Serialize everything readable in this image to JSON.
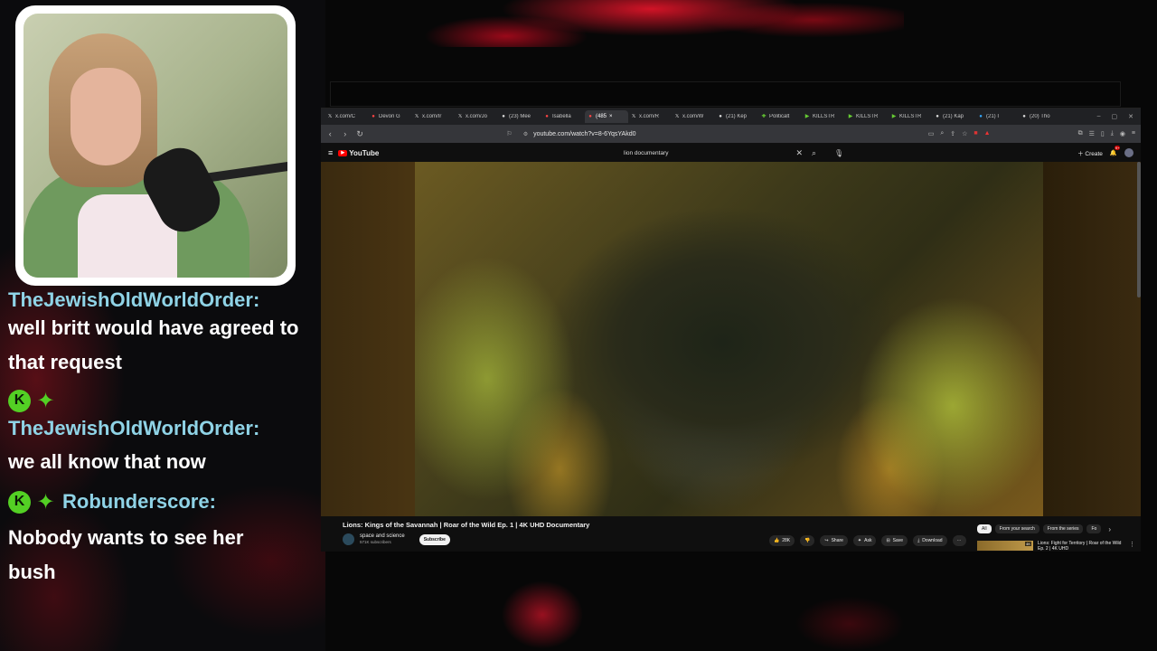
{
  "chat": {
    "lines": [
      {
        "user": "TheJewishOldWorldOrder:",
        "message": "well britt would have agreed to that request"
      },
      {
        "user": "TheJewishOldWorldOrder:",
        "message": "we all know that now"
      },
      {
        "user": "Robunderscore:",
        "message": "Nobody wants to see her bush"
      }
    ],
    "badge_letter": "K"
  },
  "browser": {
    "tabs": [
      "x.com/C",
      "Devon G",
      "x.com/Ir",
      "x.com/Jo",
      "(23) Mee",
      "Isabella",
      "(485",
      "x.com/R",
      "x.com/W",
      "(21) Kep",
      "Politicalt",
      "KILLSTR",
      "KILLSTR",
      "KILLSTR",
      "(21) Kap",
      "(21) I",
      "(20) Tho"
    ],
    "active_tab_index": 6,
    "url": "youtube.com/watch?v=8-6YqsYAkd0"
  },
  "youtube": {
    "logo_text": "YouTube",
    "search_query": "lion documentary",
    "create_label": "Create",
    "notification_count": "9+",
    "video": {
      "title": "Lions: Kings of the Savannah | Roar of the Wild Ep. 1 | 4K UHD Documentary",
      "channel": "space and science",
      "subscribers": "571K subscribers",
      "subscribe_label": "Subscribe",
      "likes": "28K",
      "share_label": "Share",
      "ask_label": "Ask",
      "save_label": "Save",
      "download_label": "Download"
    },
    "chips": [
      "All",
      "From your search",
      "From the series",
      "Fo"
    ],
    "related": {
      "title": "Lions: Fight for Territory | Roar of the Wild Ep. 2 | 4K UHD",
      "badge": "4K"
    }
  },
  "colors": {
    "chat_username": "#8fd3e6",
    "badge_green": "#53d024",
    "youtube_red": "#ff0000"
  }
}
